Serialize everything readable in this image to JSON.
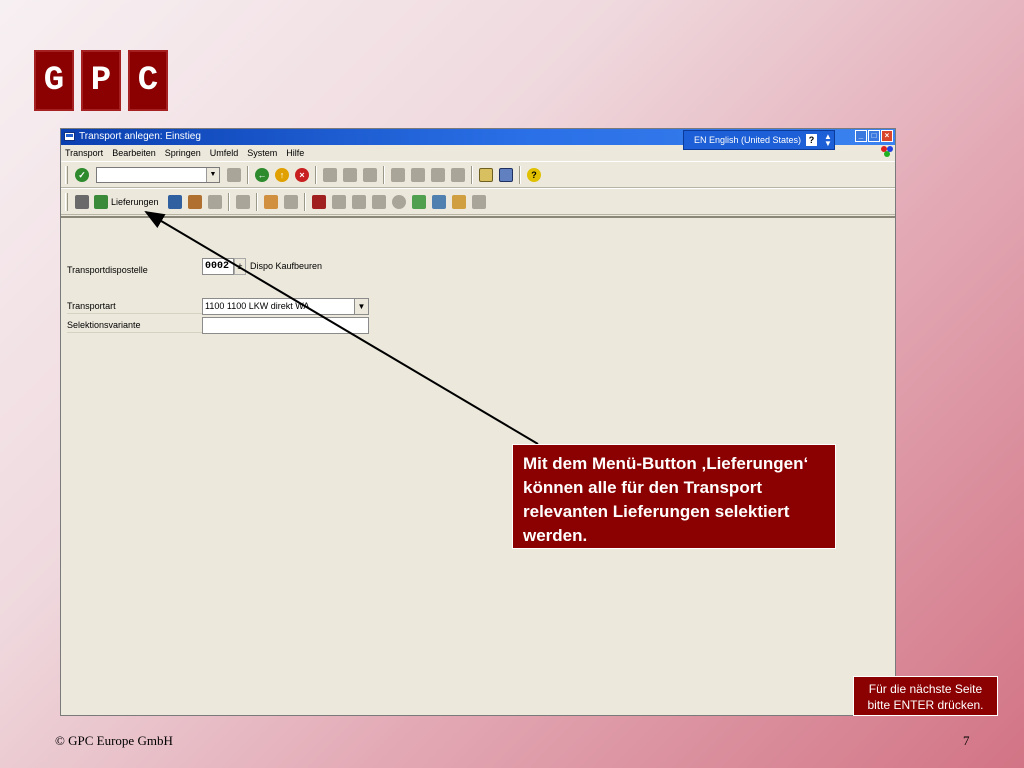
{
  "logo": {
    "letters": [
      "G",
      "P",
      "C"
    ],
    "color": "#8b0000"
  },
  "window": {
    "title": "Transport anlegen: Einstieg",
    "language": "EN English (United States)",
    "menu": [
      "Transport",
      "Bearbeiten",
      "Springen",
      "Umfeld",
      "System",
      "Hilfe"
    ],
    "toolbar2": {
      "lieferungen_label": "Lieferungen"
    }
  },
  "form": {
    "transportdispostelle": {
      "label": "Transportdispostelle",
      "value": "0002",
      "description": "Dispo  Kaufbeuren"
    },
    "transportart": {
      "label": "Transportart",
      "value": "1100 1100 LKW direkt WA"
    },
    "selektionsvariante": {
      "label": "Selektionsvariante",
      "value": ""
    }
  },
  "annotation": {
    "text": "Mit dem Menü-Button ‚Lieferungen‘ können alle für den Transport relevanten Lieferungen selektiert werden.",
    "color": "#8b0000"
  },
  "hint": {
    "line1": "Für die nächste Seite",
    "line2": "bitte ENTER drücken."
  },
  "footer": {
    "copyright": "© GPC Europe GmbH",
    "page_number": "7"
  }
}
